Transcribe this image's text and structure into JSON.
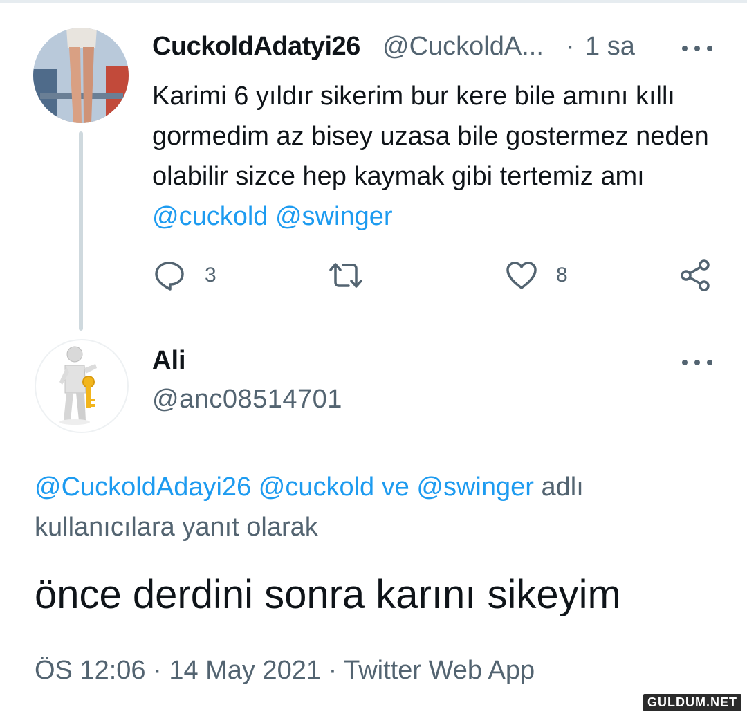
{
  "tweet": {
    "display_name": "CuckoldAdatyi26",
    "handle": "@CuckoldA...",
    "separator": "·",
    "time": "1 sa",
    "text_plain": "Karimi 6 yıldır sikerim bur kere bile amını kıllı gormedim az bisey uzasa bile gostermez neden olabilir sizce hep kaymak gibi tertemiz amı",
    "mention_1": "@cuckold",
    "mention_2": "@swinger",
    "reply_count": "3",
    "like_count": "8"
  },
  "reply": {
    "display_name": "Ali",
    "handle": "@anc08514701",
    "replying_mentions": "@CuckoldAdayi26 @cuckold ve @swinger",
    "replying_suffix": " adlı kullanıcılara yanıt olarak",
    "text": "önce derdini sonra karını sikeyim",
    "timestamp": "ÖS 12:06 · 14 May 2021 · Twitter Web App"
  },
  "watermark": "GULDUM.NET",
  "colors": {
    "accent": "#1d9bf0",
    "secondary_text": "#536471",
    "thread_line": "#cfd9de"
  },
  "icons": [
    "reply-icon",
    "retweet-icon",
    "like-icon",
    "share-icon",
    "more-icon"
  ]
}
